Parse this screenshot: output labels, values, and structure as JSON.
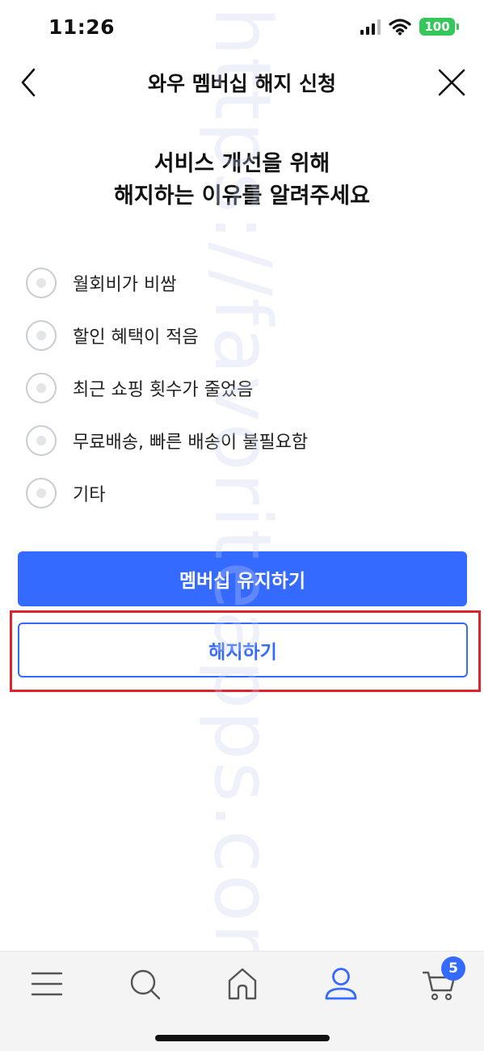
{
  "status_bar": {
    "time": "11:26",
    "battery": "100",
    "battery_color": "#34c759"
  },
  "header": {
    "title": "와우 멤버십 해지 신청",
    "back_icon": "chevron-left-icon",
    "close_icon": "close-icon"
  },
  "prompt": {
    "line1": "서비스 개선을 위해",
    "line2": "해지하는 이유를 알려주세요"
  },
  "reasons": [
    {
      "label": "월회비가 비쌈"
    },
    {
      "label": "할인 혜택이 적음"
    },
    {
      "label": "최근 쇼핑 횟수가 줄었음"
    },
    {
      "label": "무료배송, 빠른 배송이 불필요함"
    },
    {
      "label": "기타"
    }
  ],
  "buttons": {
    "keep_label": "멤버십 유지하기",
    "cancel_label": "해지하기"
  },
  "colors": {
    "accent": "#346aff",
    "highlight": "#e0222c"
  },
  "watermark": "https://favoriteapps.com/",
  "tab_bar": {
    "tabs": [
      {
        "icon": "menu-icon"
      },
      {
        "icon": "search-icon"
      },
      {
        "icon": "home-icon"
      },
      {
        "icon": "user-icon",
        "active": true
      },
      {
        "icon": "cart-icon"
      }
    ],
    "cart_badge": "5"
  }
}
